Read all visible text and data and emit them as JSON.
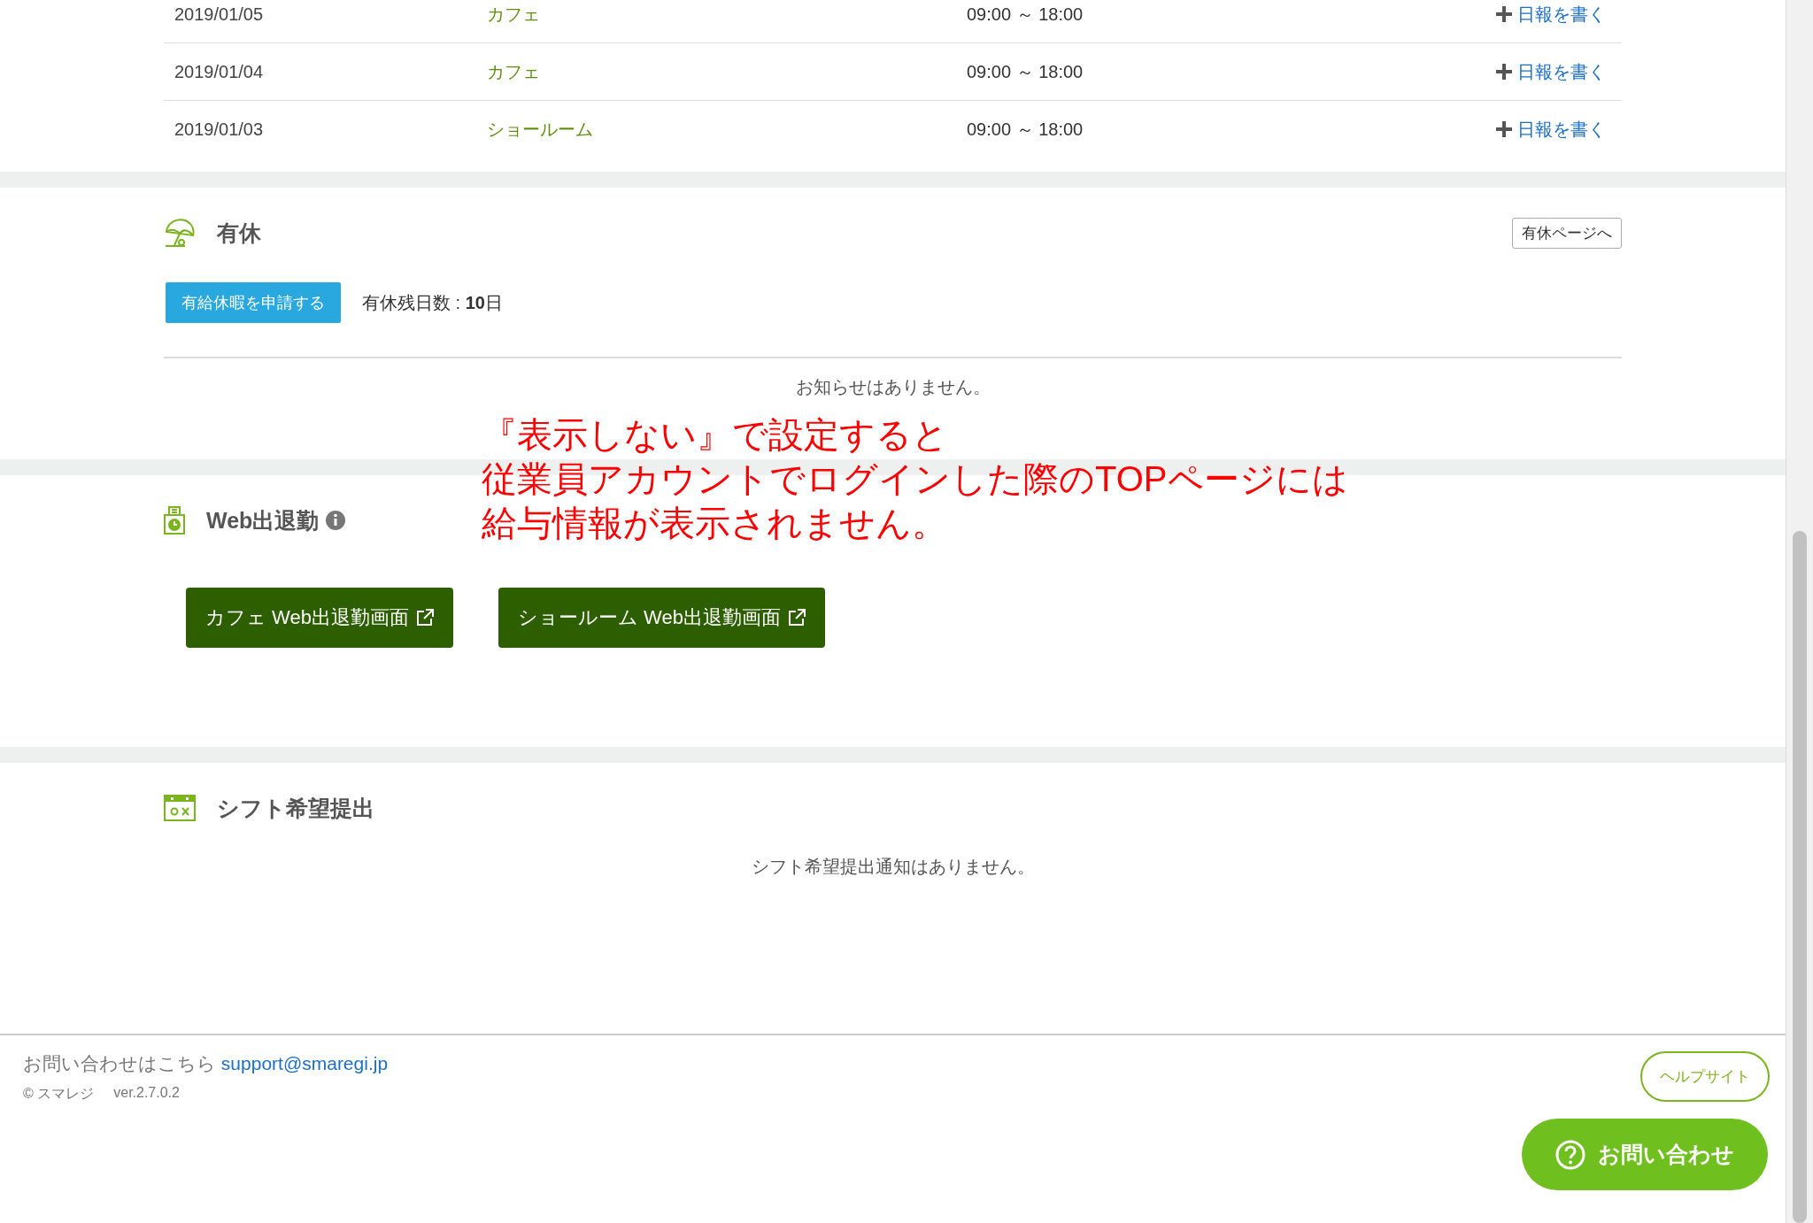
{
  "attendance_rows": [
    {
      "date": "2019/01/05",
      "shop": "カフェ",
      "hours": "09:00 ～ 18:00",
      "action": "日報を書く"
    },
    {
      "date": "2019/01/04",
      "shop": "カフェ",
      "hours": "09:00 ～ 18:00",
      "action": "日報を書く"
    },
    {
      "date": "2019/01/03",
      "shop": "ショールーム",
      "hours": "09:00 ～ 18:00",
      "action": "日報を書く"
    }
  ],
  "paid_leave": {
    "title": "有休",
    "page_button": "有休ページへ",
    "apply_button": "有給休暇を申請する",
    "remaining": "有休残日数 : **10**日",
    "notice": "お知らせはありません。"
  },
  "annotation": {
    "lines": [
      "『表示しない』で設定すると",
      "従業員アカウントでログインした際のTOPページには",
      "給与情報が表示されません。"
    ]
  },
  "web_attendance": {
    "title": "Web出退勤",
    "buttons": [
      "カフェ Web出退勤画面",
      "ショールーム Web出退勤画面"
    ]
  },
  "shift_request": {
    "title": "シフト希望提出",
    "notice": "シフト希望提出通知はありません。"
  },
  "footer": {
    "contact_label": "お問い合わせはこちら",
    "contact_email": "support@smaregi.jp",
    "copyright": "© スマレジ",
    "version": "ver.2.7.0.2",
    "help_button": "ヘルプサイト",
    "inquiry_button": "お問い合わせ"
  }
}
